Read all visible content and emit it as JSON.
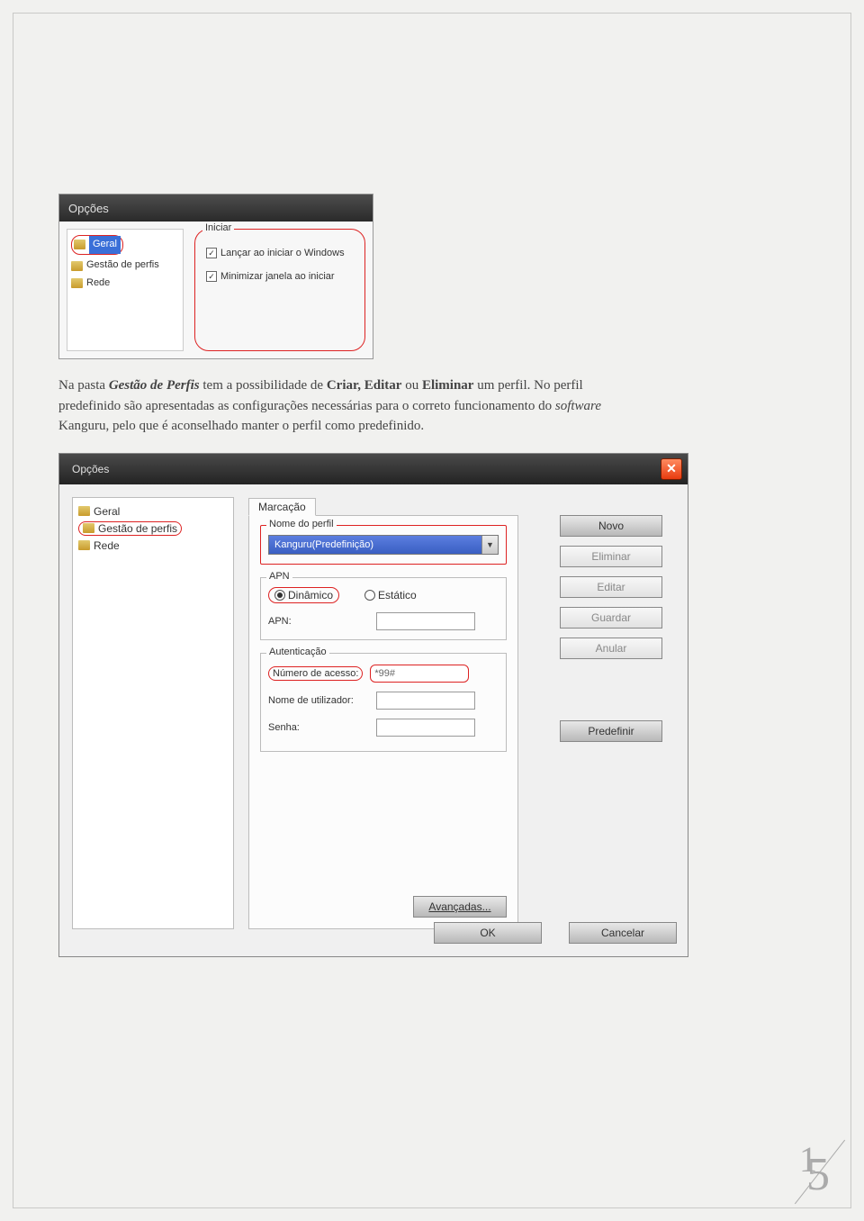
{
  "shot1": {
    "title": "Opções",
    "tree": {
      "geral": "Geral",
      "gestao": "Gestão de perfis",
      "rede": "Rede"
    },
    "iniciar": {
      "legend": "Iniciar",
      "opt1": "Lançar ao iniciar o Windows",
      "opt2": "Minimizar janela ao iniciar"
    }
  },
  "para": {
    "t1": "Na pasta ",
    "b1": "Gestão de Perfis",
    "t2": " tem a possibilidade de ",
    "b2": "Criar, Editar",
    "t3": " ou ",
    "b3": "Eliminar",
    "t4": " um perfil. No perfil predefinido são apresentadas as configurações necessárias para o correto funcionamento do ",
    "i1": "software",
    "t5": " Kanguru, pelo que é aconselhado manter o perfil como predefinido."
  },
  "shot2": {
    "title": "Opções",
    "tree": {
      "geral": "Geral",
      "gestao": "Gestão de perfis",
      "rede": "Rede"
    },
    "tab": "Marcação",
    "nome": {
      "legend": "Nome do perfil",
      "value": "Kanguru(Predefinição)"
    },
    "apn": {
      "legend": "APN",
      "opt_dyn": "Dinâmico",
      "opt_sta": "Estático",
      "apn_label": "APN:"
    },
    "auth": {
      "legend": "Autenticação",
      "num_label": "Número de acesso:",
      "num_value": "*99#",
      "user_label": "Nome de utilizador:",
      "pass_label": "Senha:"
    },
    "buttons": {
      "novo": "Novo",
      "eliminar": "Eliminar",
      "editar": "Editar",
      "guardar": "Guardar",
      "anular": "Anular",
      "predef": "Predefinir",
      "avancadas": "Avançadas...",
      "ok": "OK",
      "cancelar": "Cancelar"
    }
  },
  "page_number": {
    "d1": "1",
    "d2": "5"
  }
}
